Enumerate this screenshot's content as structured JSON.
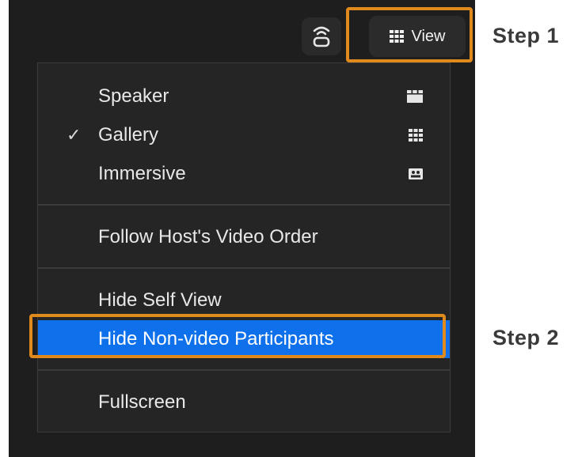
{
  "toolbar": {
    "view_label": "View",
    "icons": {
      "left": "cast-icon",
      "view": "grid-icon"
    }
  },
  "annotations": {
    "step1": "Step 1",
    "step2": "Step 2",
    "highlight_color": "#e08a1e"
  },
  "menu": {
    "layout": [
      {
        "label": "Speaker",
        "checked": false,
        "icon": "speaker-layout-icon"
      },
      {
        "label": "Gallery",
        "checked": true,
        "icon": "gallery-grid-icon"
      },
      {
        "label": "Immersive",
        "checked": false,
        "icon": "immersive-icon"
      }
    ],
    "follow_host": "Follow Host's Video Order",
    "hide_self_view": "Hide Self View",
    "hide_non_video": "Hide Non-video Participants",
    "fullscreen": "Fullscreen",
    "check_glyph": "✓",
    "selected_color": "#0e71eb"
  }
}
